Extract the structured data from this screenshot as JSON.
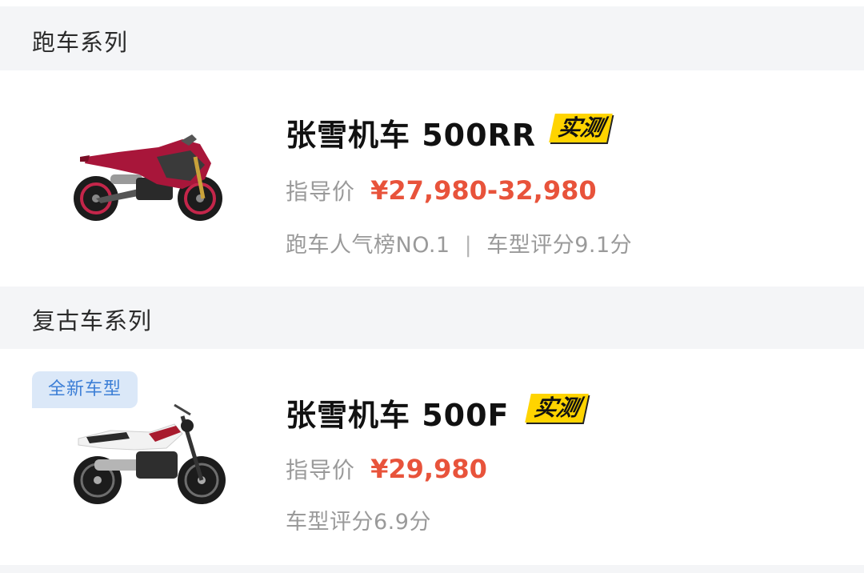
{
  "sections": [
    {
      "title": "跑车系列",
      "card": {
        "badge": "",
        "model_name": "张雪机车 500RR",
        "tag": "实测",
        "price_label": "指导价",
        "price_value": "¥27,980-32,980",
        "meta_primary": "跑车人气榜NO.1",
        "meta_separator": "|",
        "meta_secondary": "车型评分9.1分",
        "image": "red-sport-motorcycle"
      }
    },
    {
      "title": "复古车系列",
      "card": {
        "badge": "全新车型",
        "model_name": "张雪机车 500F",
        "tag": "实测",
        "price_label": "指导价",
        "price_value": "¥29,980",
        "meta_primary": "车型评分6.9分",
        "image": "white-retro-motorcycle"
      }
    }
  ],
  "colors": {
    "price": "#e8533b",
    "tag_bg": "#ffd400",
    "badge_bg": "#dbe8f8",
    "badge_text": "#3d7fd6",
    "section_bg": "#f4f5f7"
  }
}
